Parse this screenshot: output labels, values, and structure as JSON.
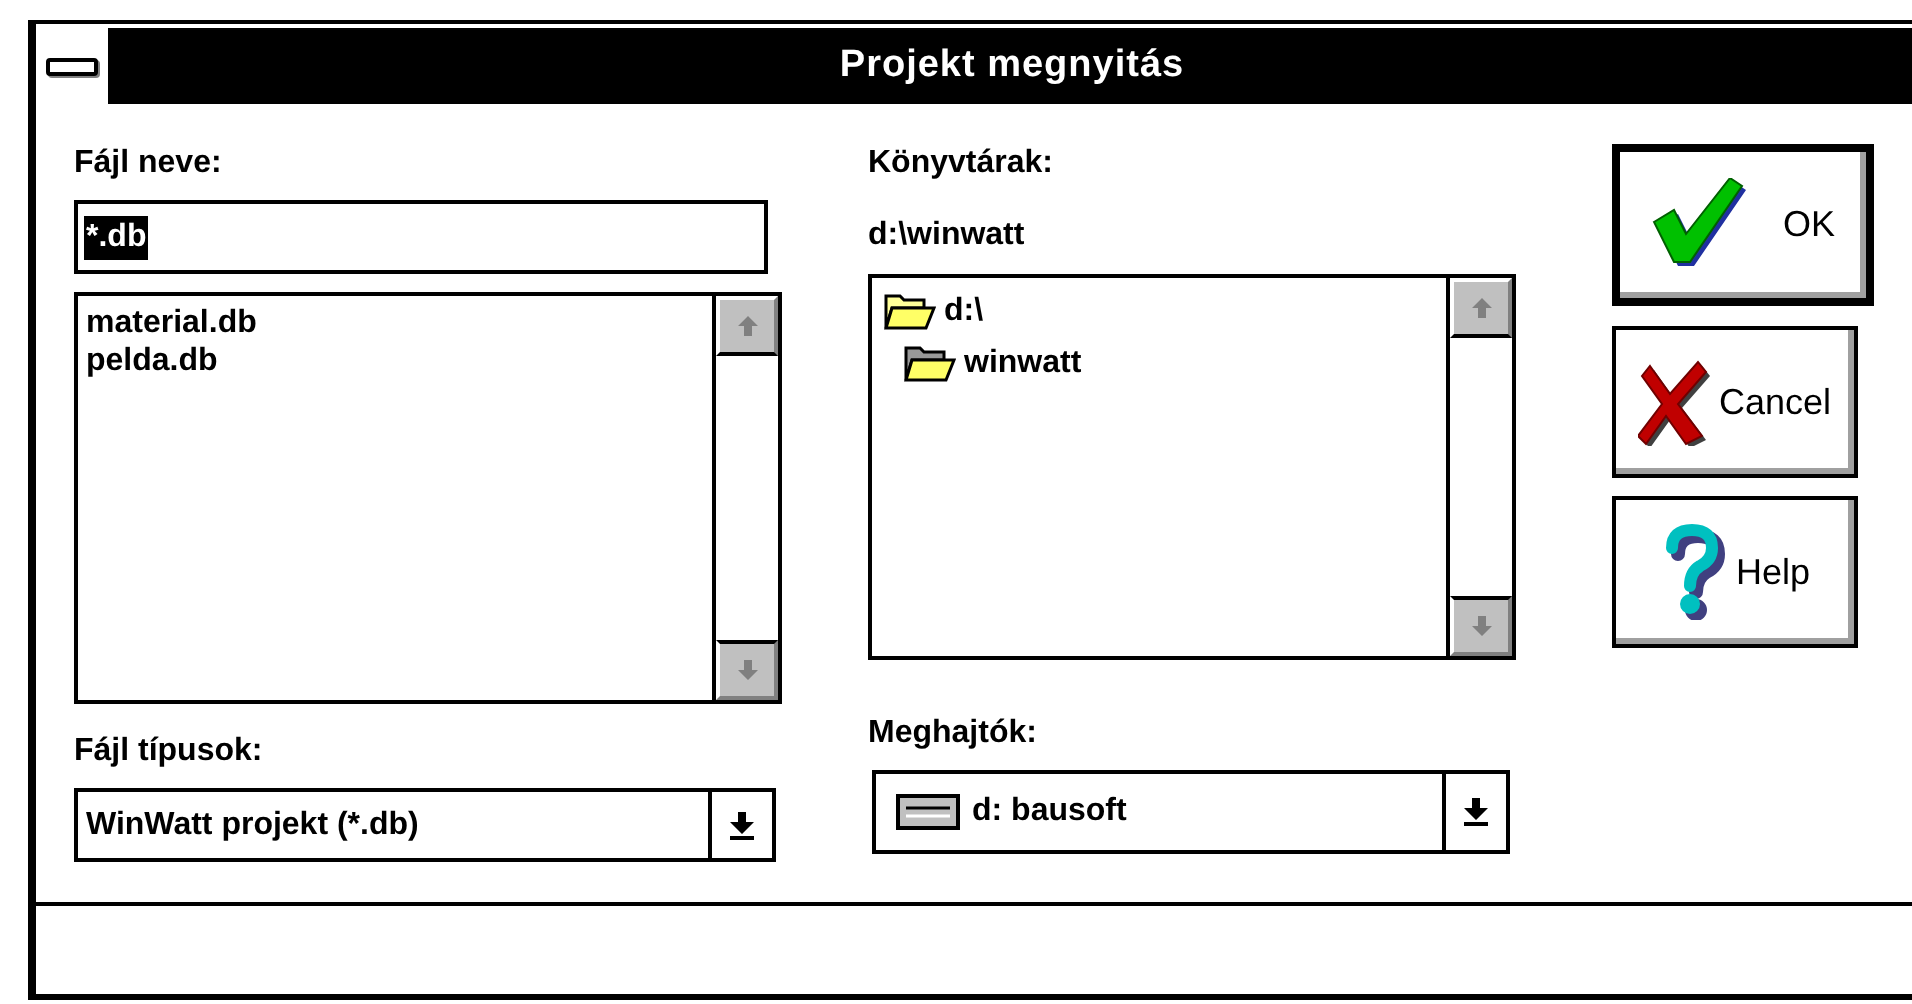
{
  "window": {
    "title": "Projekt megnyitás"
  },
  "file_name": {
    "label": "Fájl neve:",
    "value": "*.db",
    "value_selected": true
  },
  "files": [
    {
      "name": "material.db"
    },
    {
      "name": "pelda.db"
    }
  ],
  "file_types": {
    "label": "Fájl típusok:",
    "value": "WinWatt projekt (*.db)"
  },
  "directories": {
    "label": "Könyvtárak:",
    "current_path": "d:\\winwatt",
    "tree": [
      {
        "name": "d:\\",
        "kind": "open",
        "children": [
          {
            "name": "winwatt",
            "kind": "current"
          }
        ]
      }
    ]
  },
  "drives": {
    "label": "Meghajtók:",
    "value": "d: bausoft"
  },
  "buttons": [
    {
      "label": "OK",
      "kind": "ok",
      "default": true
    },
    {
      "label": "Cancel",
      "kind": "cancel",
      "default": false
    },
    {
      "label": "Help",
      "kind": "help",
      "default": false
    }
  ]
}
